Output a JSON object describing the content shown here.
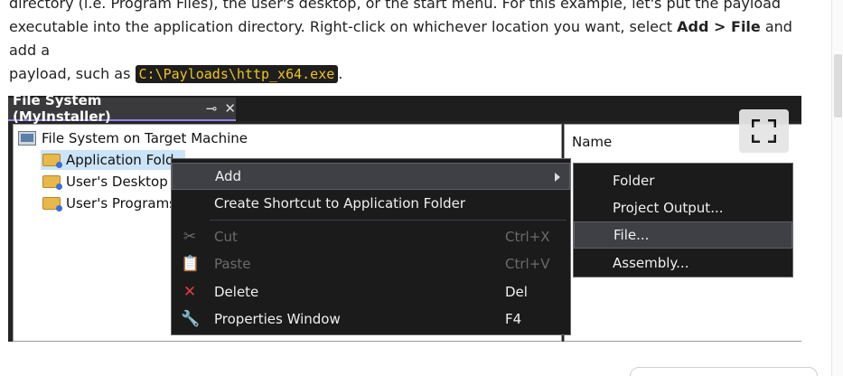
{
  "article": {
    "line1": "directory (i.e. Program Files), the user's desktop, or the start menu.   For this example, let's put the payload",
    "line2_prefix": "executable into the application directory.  Right-click on whichever location you want, select ",
    "line2_bold": "Add > File",
    "line2_suffix": " and add a",
    "line3_prefix": "payload, such as ",
    "line3_code": "C:\\Payloads\\http_x64.exe",
    "line3_suffix": "."
  },
  "window": {
    "tab_title": "File System (MyInstaller)",
    "pin_glyph": "⊸",
    "close_glyph": "✕",
    "column_header": "Name"
  },
  "tree": {
    "root": "File System on Target Machine",
    "items": [
      "Application Fold",
      "User's Desktop",
      "User's Programs"
    ]
  },
  "context_menu": {
    "items": [
      {
        "label": "Add",
        "shortcut": ""
      },
      {
        "label": "Create Shortcut to Application Folder",
        "shortcut": ""
      },
      {
        "label": "Cut",
        "shortcut": "Ctrl+X"
      },
      {
        "label": "Paste",
        "shortcut": "Ctrl+V"
      },
      {
        "label": "Delete",
        "shortcut": "Del"
      },
      {
        "label": "Properties Window",
        "shortcut": "F4"
      }
    ]
  },
  "submenu": {
    "items": [
      "Folder",
      "Project Output...",
      "File...",
      "Assembly..."
    ]
  },
  "colors": {
    "menu_bg": "#1b1b1c",
    "menu_highlight": "#3f3f46",
    "tab_accent": "#9184ee",
    "code_text": "#f0c419"
  }
}
